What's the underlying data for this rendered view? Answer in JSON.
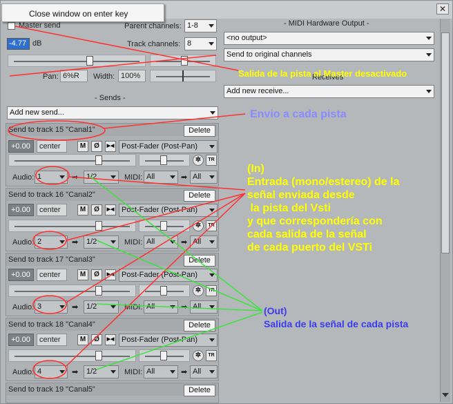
{
  "window": {
    "close_glyph": "✕",
    "context_menu_item": "Close window on enter key"
  },
  "master": {
    "master_send_label": "Master send",
    "parent_channels_label": "Parent channels:",
    "parent_channels_value": "1-8",
    "volume_value": "-4.77",
    "volume_unit": "dB",
    "track_channels_label": "Track channels:",
    "track_channels_value": "8",
    "pan_label": "Pan:",
    "pan_value": "6%R",
    "width_label": "Width:",
    "width_value": "100%"
  },
  "midi_hw": {
    "title": "MIDI Hardware Output",
    "output_value": "<no output>",
    "channels_value": "Send to original channels"
  },
  "receives": {
    "title": "Receives",
    "add_new_receive": "Add new receive..."
  },
  "sends": {
    "title": "Sends",
    "add_new_send": "Add new send...",
    "delete_label": "Delete",
    "volume_default": "+0.00",
    "pan_default": "center",
    "mute_label": "M",
    "phase_label": "Ø",
    "mono_label": "▶◀",
    "fader_mode": "Post-Fader (Post-Pan)",
    "audio_label": "Audio:",
    "out_channel": "1/2",
    "midi_label": "MIDI:",
    "midi_in": "All",
    "midi_out": "All",
    "tr_label": "TR",
    "items": [
      {
        "title": "Send to track 15 \"Canal1\"",
        "audio_in": "1"
      },
      {
        "title": "Send to track 16 \"Canal2\"",
        "audio_in": "2"
      },
      {
        "title": "Send to track 17 \"Canal3\"",
        "audio_in": "3"
      },
      {
        "title": "Send to track 18 \"Canal4\"",
        "audio_in": "4"
      },
      {
        "title": "Send to track 19 \"Canal5\""
      }
    ]
  },
  "annotations": {
    "master_off": "Salida de la pista al Master desactivado",
    "send_each": "Envio a cada pista",
    "in_line1": "(In)",
    "in_line2": "Entrada (mono/estereo) de la",
    "in_line3": "señal enviada desde",
    "in_line4": " la pista del Vsti",
    "in_line5": "y que correspondería con",
    "in_line6": "cada salida de la señal",
    "in_line7": "de cada puerto del VSTi",
    "out_line1": "(Out)",
    "out_line2": "Salida de la señal de cada pista"
  },
  "colors": {
    "yellow": "#ffff00",
    "blue_violet": "#8a8aff",
    "blue": "#3a3af0",
    "red_line": "#ff3030",
    "green_line": "#40e040"
  }
}
